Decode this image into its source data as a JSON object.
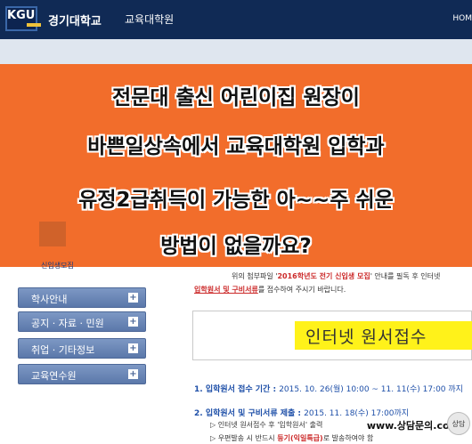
{
  "header": {
    "logo_text": "KGU",
    "university": "경기대학교",
    "graduate_school": "교육대학원",
    "home_link": "HOM"
  },
  "banner": {
    "color": "#f26d2b",
    "lines": [
      "전문대 출신 어린이집 원장이",
      "바쁜일상속에서 교육대학원 입학과",
      "유정2급취득이 가능한 아~~주 쉬운",
      "방법이 없을까요?"
    ]
  },
  "left": {
    "recruit_label": "신입생모집",
    "menu": [
      {
        "label": "학사안내",
        "plus": "+"
      },
      {
        "label": "공지 · 자료 · 민원",
        "plus": "+"
      },
      {
        "label": "취업 · 기타정보",
        "plus": "+"
      },
      {
        "label": "교육연수원",
        "plus": "+"
      }
    ]
  },
  "content": {
    "notice_line1_pre": "위의 첨부파일 '",
    "notice_line1_em": "2016학년도 전기 신입생 모집",
    "notice_line1_post": "' 안내를 필독 후 인터넷",
    "notice_line2_em": "입학원서 및 구비서류",
    "notice_line2_post": "를 접수하여 주시기 바랍니다.",
    "online_box_text": "인터넷 원서접수",
    "section1_title": "1. 입학원서 접수 기간 : ",
    "section1_value": "2015. 10. 26(월) 10:00 ~ 11. 11(수) 17:00 까지",
    "section2_title": "2. 입학원서 및 구비서류 제출 : ",
    "section2_value": "2015. 11. 18(수) 17:00까지",
    "sub1_pre": "▷ 인터넷 원서접수 후 '입학원서' 출력",
    "sub2_pre": "▷ 우편발송 시 반드시 ",
    "sub2_em": "등기(익일특급)",
    "sub2_post": "로 발송하여야 함"
  },
  "watermark": {
    "text": "www.상담문의.com",
    "icon": "상담"
  }
}
